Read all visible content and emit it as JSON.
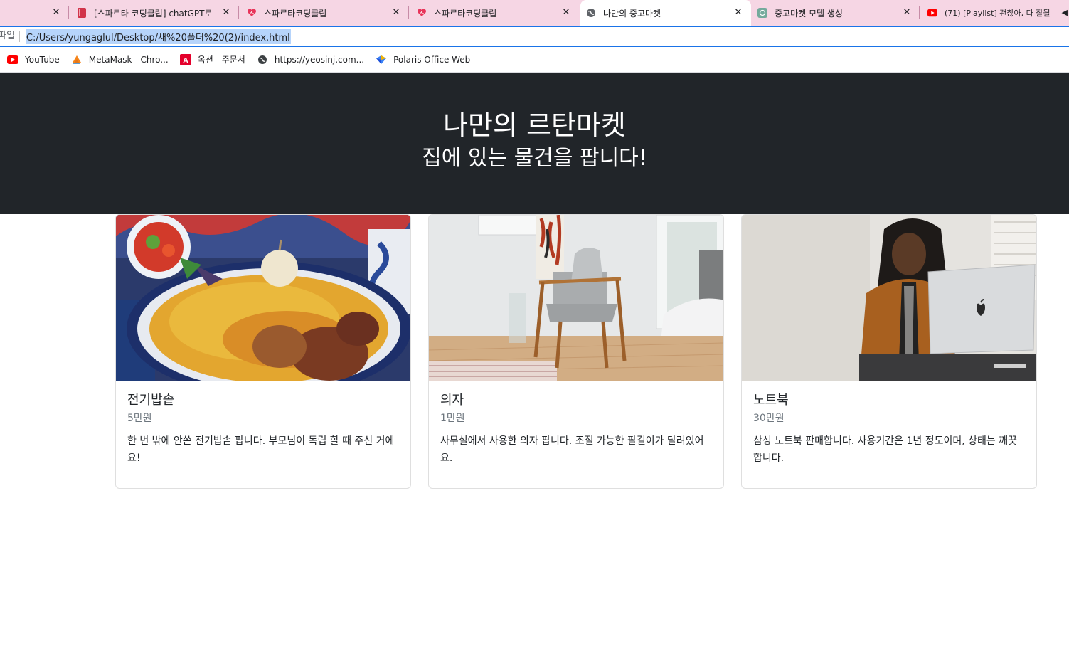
{
  "browser": {
    "tabs": [
      {
        "title": "",
        "icon": "none"
      },
      {
        "title": "[스파르타 코딩클럽] chatGPT로",
        "icon": "bookmark-red-icon"
      },
      {
        "title": "스파르타코딩클럽",
        "icon": "heart-icon"
      },
      {
        "title": "스파르타코딩클럽",
        "icon": "heart-icon"
      },
      {
        "title": "나만의 중고마켓",
        "icon": "globe-icon",
        "active": true
      },
      {
        "title": "중고마켓 모델 생성",
        "icon": "chatgpt-icon"
      },
      {
        "title": "(71) [Playlist] 괜찮아, 다 잘될",
        "icon": "youtube-icon"
      }
    ],
    "address": {
      "prefix": "파일",
      "url": "C:/Users/yungaglul/Desktop/새%20폴더%20(2)/index.html"
    },
    "bookmarks": [
      {
        "label": "YouTube",
        "icon": "youtube-icon"
      },
      {
        "label": "MetaMask - Chro...",
        "icon": "metamask-icon"
      },
      {
        "label": "옥션 - 주문서",
        "icon": "auction-icon"
      },
      {
        "label": "https://yeosinj.com...",
        "icon": "globe-icon"
      },
      {
        "label": "Polaris Office Web",
        "icon": "polaris-icon"
      }
    ]
  },
  "page": {
    "title": "나만의 르탄마켓",
    "subtitle": "집에 있는 물건을 팝니다!",
    "cards": [
      {
        "title": "전기밥솥",
        "price": "5만원",
        "desc": "한 번 밖에 안쓴 전기밥솥 팝니다. 부모님이 독립 할 때 주신 거에요!",
        "image": "food-plate-image"
      },
      {
        "title": "의자",
        "price": "1만원",
        "desc": "사무실에서 사용한 의자 팝니다. 조절 가능한 팔걸이가 달려있어요.",
        "image": "armchair-image"
      },
      {
        "title": "노트북",
        "price": "30만원",
        "desc": "삼성 노트북 판매합니다. 사용기간은 1년 정도이며, 상태는 깨끗합니다.",
        "image": "laptop-woman-image"
      }
    ]
  }
}
